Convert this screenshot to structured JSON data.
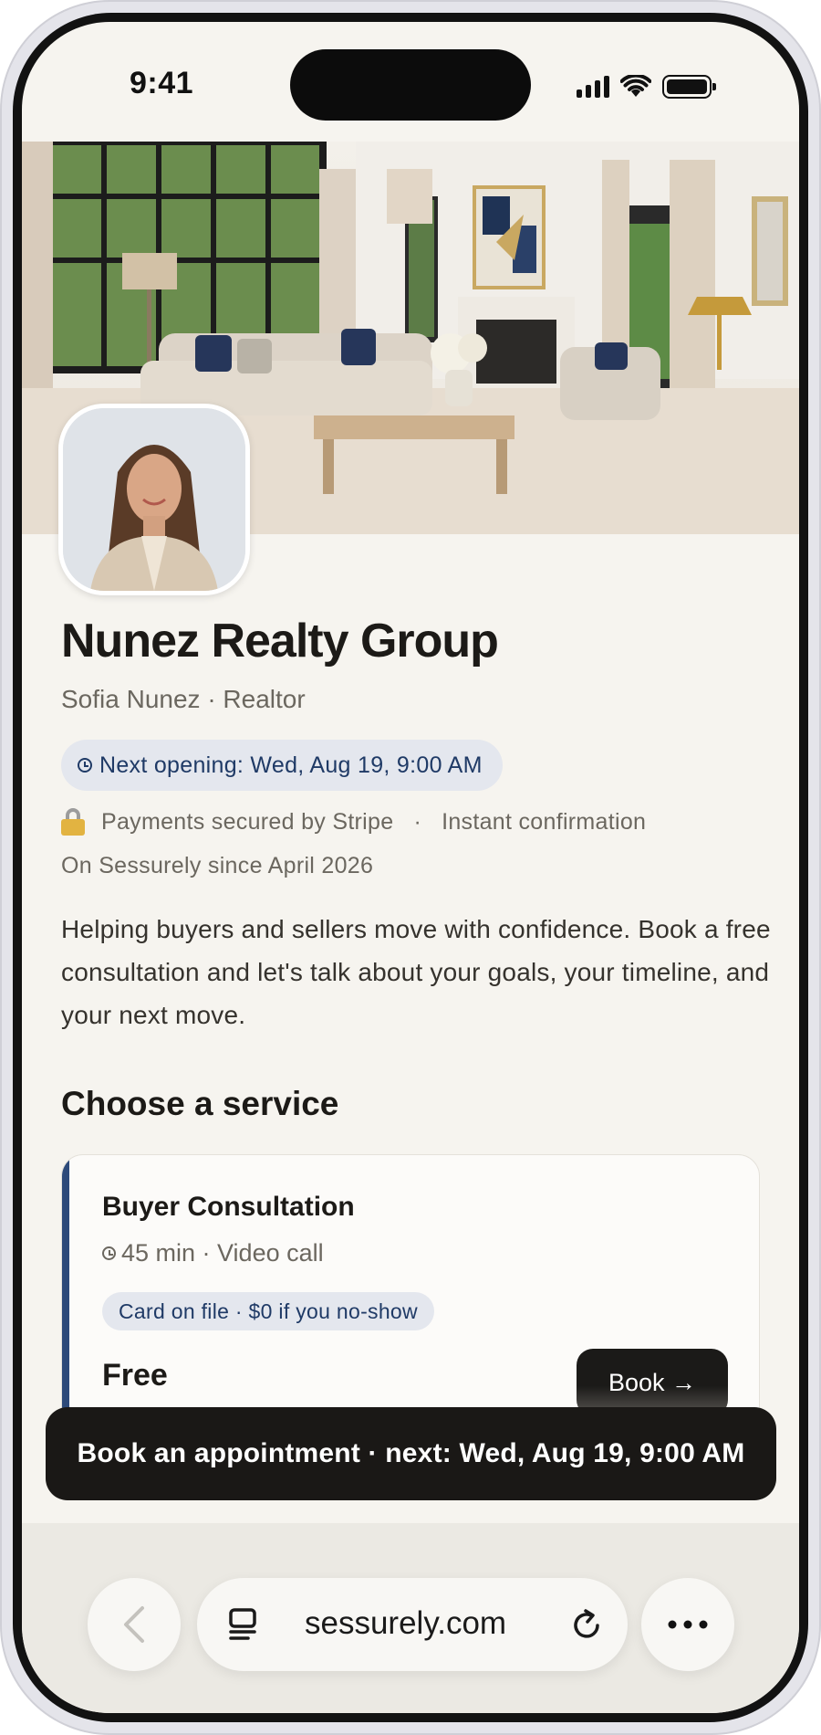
{
  "status_bar": {
    "time": "9:41"
  },
  "hero": {
    "image_alt": "living-room-photo"
  },
  "profile": {
    "business_name": "Nunez Realty Group",
    "subtitle": "Sofia Nunez · Realtor",
    "next_opening": "Next opening: Wed, Aug 19, 9:00 AM",
    "payments_note": "Payments secured by Stripe",
    "separator": "·",
    "confirmation_note": "Instant confirmation",
    "member_since": "On Sessurely since April 2026",
    "bio": "Helping buyers and sellers move with confidence. Book a free consultation and let's talk about your goals, your timeline, and your next move."
  },
  "services": {
    "section_title": "Choose a service",
    "items": [
      {
        "title": "Buyer Consultation",
        "meta": "45 min · Video call",
        "badge": "Card on file · $0 if you no-show",
        "price": "Free",
        "book_label": "Book →"
      }
    ]
  },
  "cta": {
    "label": "Book an appointment · next: Wed, Aug 19, 9:00 AM"
  },
  "browser": {
    "url": "sessurely.com",
    "back_icon": "chevron-left-icon",
    "tabs_icon": "tabs-icon",
    "reload_icon": "reload-icon",
    "more_icon": "ellipsis-icon"
  },
  "colors": {
    "accent_blue": "#1f3a66",
    "pill_bg": "#e4e7ee",
    "background": "#f6f4ef",
    "dark": "#1a1816"
  }
}
